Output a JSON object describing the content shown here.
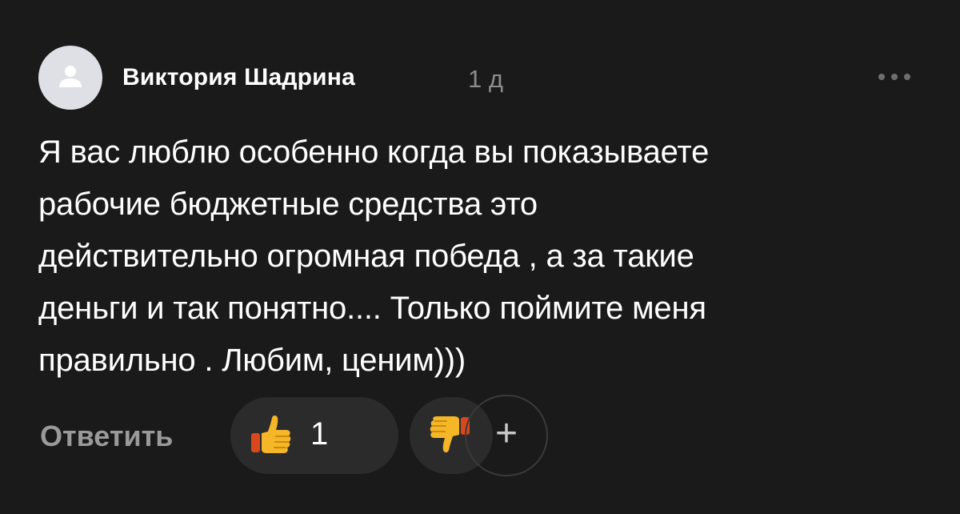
{
  "comment": {
    "author": "Виктория Шадрина",
    "time": "1 д",
    "text": "Я вас люблю особенно когда вы показываете\nрабочие бюджетные средства это\nдействительно огромная победа , а за такие\nденьги и так понятно.... Только поймите меня\nправильно . Любим, ценим)))",
    "avatar_icon": "user-silhouette-icon",
    "more_icon": "more-dots-icon"
  },
  "actions": {
    "reply_label": "Ответить",
    "like_icon": "thumbs-up-emoji-icon",
    "like_count": "1",
    "dislike_icon": "thumbs-down-emoji-icon",
    "add_icon": "plus-icon",
    "add_label": "+"
  },
  "colors": {
    "background": "#1a1a1a",
    "text": "#ffffff",
    "muted": "#8c8c8c",
    "pill": "#2b2b2b",
    "avatar": "#dfe0e6"
  }
}
